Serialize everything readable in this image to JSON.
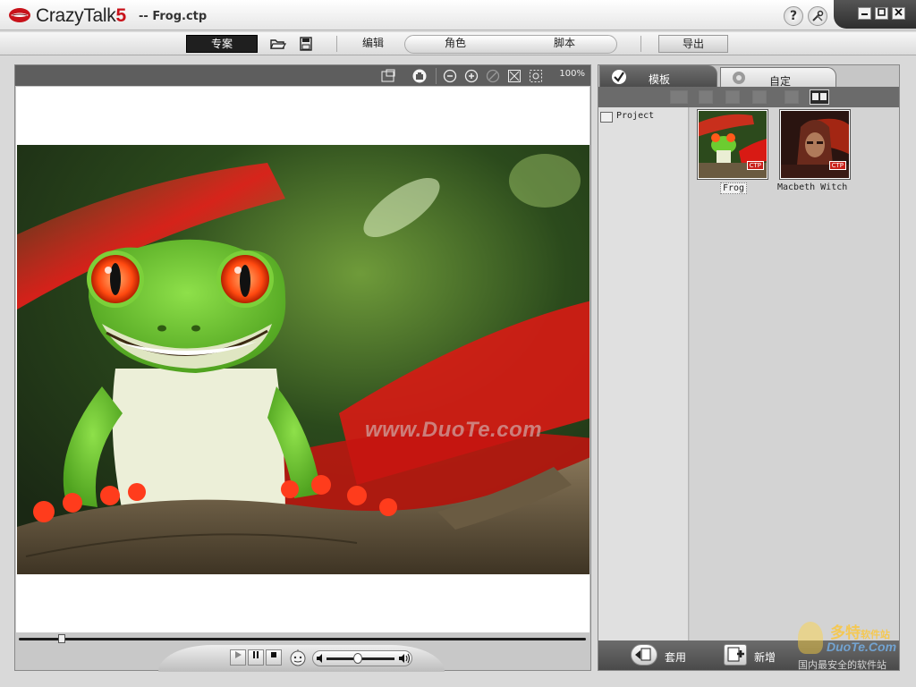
{
  "titlebar": {
    "app_name": "CrazyTalk",
    "app_version": "5",
    "file_title": "-- Frog.ctp",
    "help_label": "?",
    "colors": {
      "brand_red": "#c8121a"
    }
  },
  "toolbar": {
    "tabs": [
      {
        "id": "project",
        "label": "专案"
      },
      {
        "id": "edit",
        "label": "编辑"
      },
      {
        "id": "role",
        "label": "角色"
      },
      {
        "id": "script",
        "label": "脚本"
      },
      {
        "id": "export",
        "label": "导出"
      }
    ],
    "icons": [
      "open-folder-icon",
      "save-icon"
    ]
  },
  "viewer": {
    "zoom": "100%",
    "toolbar_icons": [
      "fit-window-icon",
      "pan-hand-icon",
      "zoom-out-icon",
      "zoom-in-icon",
      "disabled-icon",
      "fit-screen-icon",
      "zoom-region-icon"
    ],
    "watermark": "www.DuoTe.com"
  },
  "panel": {
    "tabs": [
      {
        "id": "template",
        "label": "模板"
      },
      {
        "id": "custom",
        "label": "自定"
      }
    ],
    "tree": {
      "root": "Project"
    },
    "items": [
      {
        "label": "Frog",
        "badge": "CTP"
      },
      {
        "label": "Macbeth Witch",
        "badge": "CTP"
      }
    ],
    "actions": [
      {
        "id": "apply",
        "label": "套用"
      },
      {
        "id": "new",
        "label": "新增"
      }
    ]
  },
  "site_watermark": {
    "name": "多特",
    "suffix": "软件站",
    "url": "DuoTe.Com",
    "slogan": "国内最安全的软件站"
  }
}
